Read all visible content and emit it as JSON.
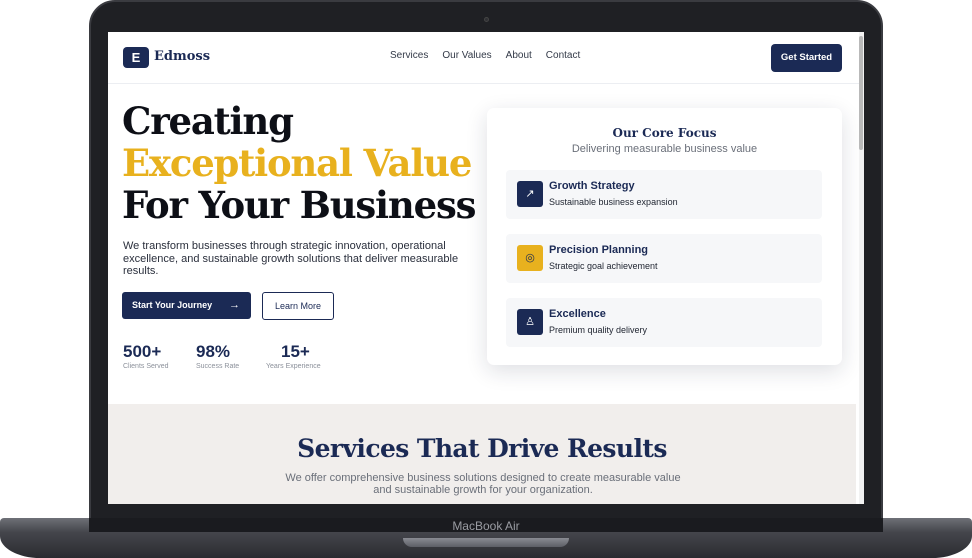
{
  "device": {
    "label": "MacBook Air"
  },
  "nav": {
    "logo_letter": "E",
    "brand": "Edmoss",
    "links": [
      "Services",
      "Our Values",
      "About",
      "Contact"
    ],
    "cta": "Get Started"
  },
  "hero": {
    "title_line1": "Creating",
    "title_line2": "Exceptional Value",
    "title_line3": "For Your Business",
    "description": "We transform businesses through strategic innovation, operational excellence, and sustainable growth solutions that deliver measurable results.",
    "primary_button": "Start Your Journey",
    "primary_arrow": "→",
    "secondary_button": "Learn More",
    "stats": [
      {
        "value": "500+",
        "label": "Clients Served"
      },
      {
        "value": "98%",
        "label": "Success Rate"
      },
      {
        "value": "15+",
        "label": "Years Experience"
      }
    ]
  },
  "card": {
    "title": "Our Core Focus",
    "subtitle": "Delivering measurable business value",
    "items": [
      {
        "name": "Growth Strategy",
        "desc": "Sustainable business expansion",
        "icon": "trending-up-icon",
        "glyph": "↗"
      },
      {
        "name": "Precision Planning",
        "desc": "Strategic goal achievement",
        "icon": "target-icon",
        "glyph": "◎"
      },
      {
        "name": "Excellence",
        "desc": "Premium quality delivery",
        "icon": "award-icon",
        "glyph": "♙"
      }
    ]
  },
  "services": {
    "title": "Services That Drive Results",
    "description": "We offer comprehensive business solutions designed to create measurable value and sustainable growth for your organization."
  },
  "colors": {
    "brand": "#1b2a55",
    "accent": "#e8b11e",
    "section_bg": "#f1eeec"
  }
}
